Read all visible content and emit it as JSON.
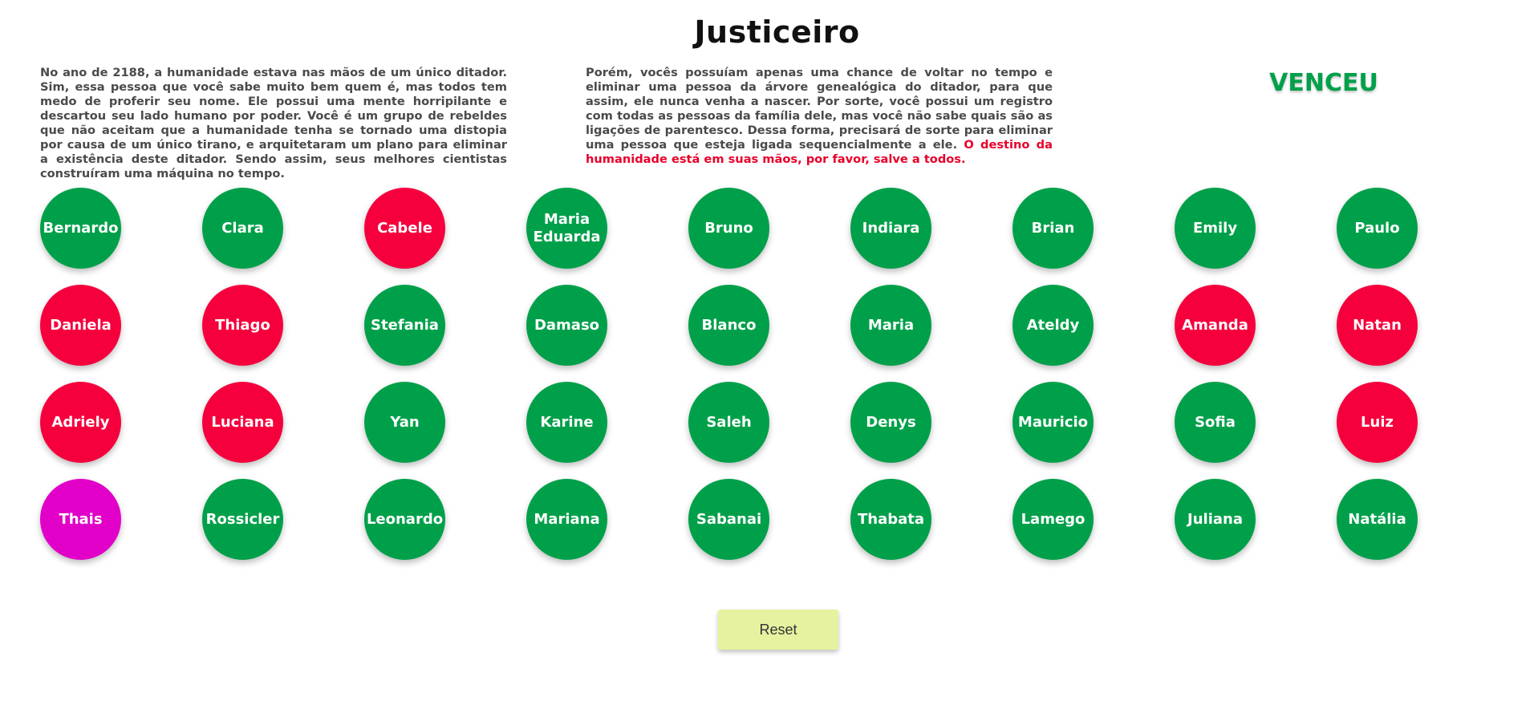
{
  "title": "Justiceiro",
  "story": {
    "left": "No ano de 2188, a humanidade estava nas mãos de um único ditador. Sim, essa pessoa que você sabe muito bem quem é, mas todos tem medo de proferir seu nome. Ele possui uma mente horripilante e descartou seu lado humano por poder. Você é um grupo de rebeldes que não aceitam que a humanidade tenha se tornado uma distopia por causa de um único tirano, e arquitetaram um plano para eliminar a existência deste ditador. Sendo assim, seus melhores cientistas construíram uma máquina no tempo.",
    "right": "Porém, vocês possuíam apenas uma chance de voltar no tempo e eliminar uma pessoa da árvore genealógica do ditador, para que assim, ele nunca venha a nascer. Por sorte, você possui um registro com todas as pessoas da família dele, mas você não sabe quais são as ligações de parentesco. Dessa forma, precisará de sorte para eliminar uma pessoa que esteja ligada sequencialmente a ele.",
    "warning": "O destino da humanidade está em suas mãos, por favor, salve a todos."
  },
  "status": "VENCEU",
  "colors": {
    "safe": "#00a04a",
    "eliminated": "#f5003d",
    "dictator": "#e000c8",
    "status": "#00a04a",
    "reset": "#e6f2a0"
  },
  "people": [
    [
      {
        "name": "Bernardo",
        "state": "green"
      },
      {
        "name": "Clara",
        "state": "green"
      },
      {
        "name": "Cabele",
        "state": "red"
      },
      {
        "name": "Maria Eduarda",
        "state": "green"
      },
      {
        "name": "Bruno",
        "state": "green"
      },
      {
        "name": "Indiara",
        "state": "green"
      },
      {
        "name": "Brian",
        "state": "green"
      },
      {
        "name": "Emily",
        "state": "green"
      },
      {
        "name": "Paulo",
        "state": "green"
      }
    ],
    [
      {
        "name": "Daniela",
        "state": "red"
      },
      {
        "name": "Thiago",
        "state": "red"
      },
      {
        "name": "Stefania",
        "state": "green"
      },
      {
        "name": "Damaso",
        "state": "green"
      },
      {
        "name": "Blanco",
        "state": "green"
      },
      {
        "name": "Maria",
        "state": "green"
      },
      {
        "name": "Ateldy",
        "state": "green"
      },
      {
        "name": "Amanda",
        "state": "red"
      },
      {
        "name": "Natan",
        "state": "red"
      }
    ],
    [
      {
        "name": "Adriely",
        "state": "red"
      },
      {
        "name": "Luciana",
        "state": "red"
      },
      {
        "name": "Yan",
        "state": "green"
      },
      {
        "name": "Karine",
        "state": "green"
      },
      {
        "name": "Saleh",
        "state": "green"
      },
      {
        "name": "Denys",
        "state": "green"
      },
      {
        "name": "Mauricio",
        "state": "green"
      },
      {
        "name": "Sofia",
        "state": "green"
      },
      {
        "name": "Luiz",
        "state": "red"
      }
    ],
    [
      {
        "name": "Thais",
        "state": "magenta"
      },
      {
        "name": "Rossicler",
        "state": "green"
      },
      {
        "name": "Leonardo",
        "state": "green"
      },
      {
        "name": "Mariana",
        "state": "green"
      },
      {
        "name": "Sabanai",
        "state": "green"
      },
      {
        "name": "Thabata",
        "state": "green"
      },
      {
        "name": "Lamego",
        "state": "green"
      },
      {
        "name": "Juliana",
        "state": "green"
      },
      {
        "name": "Natália",
        "state": "green"
      }
    ]
  ],
  "reset_label": "Reset"
}
